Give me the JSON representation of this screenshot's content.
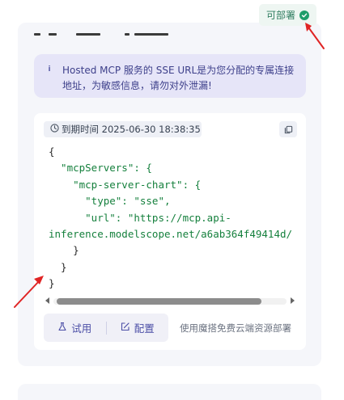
{
  "status": {
    "deploy_label": "可部署",
    "icon": "check-circle-icon",
    "color": "#1f9d6a"
  },
  "notice": {
    "icon": "info-icon",
    "text_line1": "Hosted MCP 服务的 SSE URL是为您分配的专属连接",
    "text_line2": "地址，为敏感信息，请勿对外泄漏!"
  },
  "config": {
    "expiry_label": "到期时间 2025-06-30 18:38:35",
    "copy_icon": "copy-icon",
    "code_lines": [
      "{",
      "  \"mcpServers\": {",
      "    \"mcp-server-chart\": {",
      "      \"type\": \"sse\",",
      "      \"url\": \"https://mcp.api-",
      "inference.modelscope.net/a6ab364f49414d/",
      "    }",
      "  }",
      "}"
    ]
  },
  "actions": {
    "try_label": "试用",
    "configure_label": "配置",
    "note": "使用魔搭免费云端资源部署"
  },
  "colors": {
    "accent": "#4b4ea6",
    "annotation": "#e02424",
    "json_key": "#15803d"
  }
}
